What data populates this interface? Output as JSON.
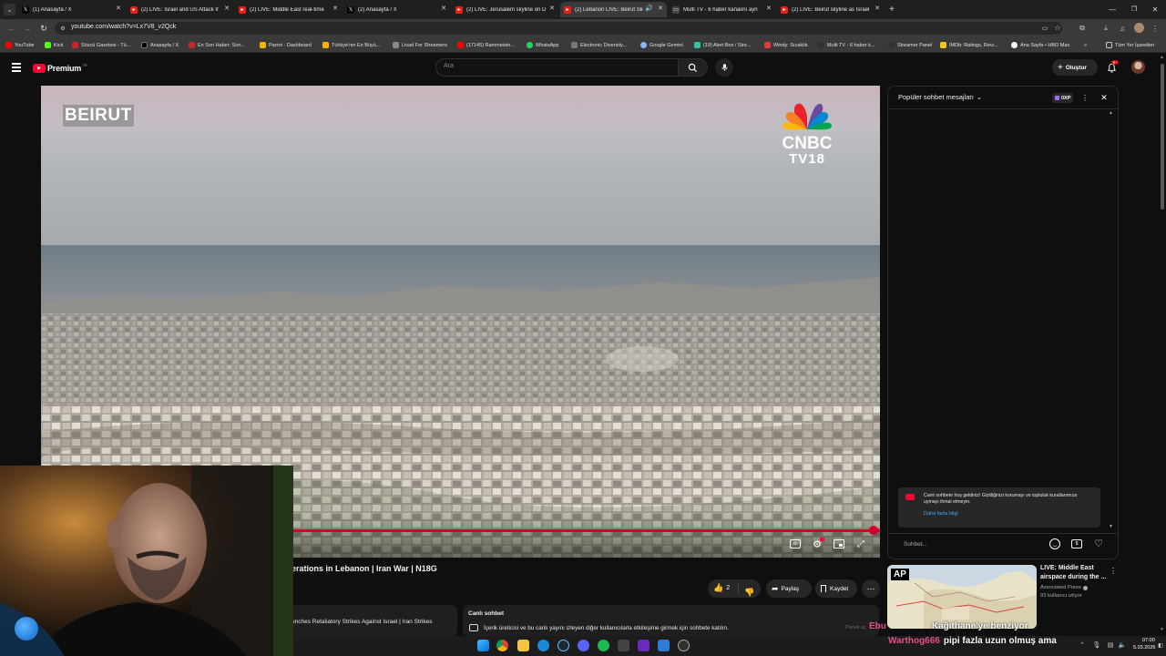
{
  "tabs": [
    {
      "title": "(1) Anasayfa / X",
      "favicon": "x-icon"
    },
    {
      "title": "(2) LIVE: Israel and US Attack Ir",
      "favicon": "youtube-icon"
    },
    {
      "title": "(2) LIVE: Middle East real-time",
      "favicon": "youtube-icon"
    },
    {
      "title": "(2) Anasayfa / X",
      "favicon": "x-icon"
    },
    {
      "title": "(2) LIVE: Jerusalem skyline on D",
      "favicon": "youtube-icon"
    },
    {
      "title": "(2) Lebanon LIVE: Beirut Sk",
      "favicon": "youtube-icon"
    },
    {
      "title": "Multi TV - 6 haber kanalını ayn",
      "favicon": "tv-icon"
    },
    {
      "title": "(2) LIVE: Beirut skyline as Israel",
      "favicon": "youtube-icon"
    }
  ],
  "address": {
    "url": "youtube.com/watch?v=Lx7V8_v2Qck"
  },
  "bookmarks": [
    {
      "label": "YouTube",
      "color": "#ff0000"
    },
    {
      "label": "Kick",
      "color": "#53fc18"
    },
    {
      "label": "Sözcü Gazetesi - Tü...",
      "color": "#d0202a"
    },
    {
      "label": "Anasayfa / X",
      "color": "#000000"
    },
    {
      "label": "En Son Haber: Son...",
      "color": "#c62828"
    },
    {
      "label": "Parrot - Dashboard",
      "color": "#f4b400"
    },
    {
      "label": "Türkiye'nin En Büyü...",
      "color": "#ffb300"
    },
    {
      "label": "Livad For Streamers",
      "color": "#888888"
    },
    {
      "label": "(17145) Rammstein...",
      "color": "#ff0000"
    },
    {
      "label": "WhatsApp",
      "color": "#25d366"
    },
    {
      "label": "Electronic Diversity...",
      "color": "#777777"
    },
    {
      "label": "Google Gemini",
      "color": "#8ab4f8"
    },
    {
      "label": "(19) Alert Box / Stre...",
      "color": "#31c3a2"
    },
    {
      "label": "Windy: Sıcaklık",
      "color": "#e53935"
    },
    {
      "label": "Multi TV - 6 haber k...",
      "color": "#333333"
    },
    {
      "label": "Streamer Panel",
      "color": "#333333"
    },
    {
      "label": "IMDb: Ratings, Revi...",
      "color": "#f5c518"
    },
    {
      "label": "Ana Sayfa • HBO Max",
      "color": "#ffffff"
    }
  ],
  "bookmarks_more": "»",
  "bookmarks_all": "Tüm Yer İşaretleri",
  "yt": {
    "logo_text": "Premium",
    "logo_badge": "TR",
    "search_placeholder": "Ara",
    "create_label": "Oluştur",
    "notif_count": "9+"
  },
  "video": {
    "location_overlay": "BEIRUT",
    "channel_logo_line1": "CNBC",
    "channel_logo_line2": "TV18",
    "progress": 1.0
  },
  "below_video": {
    "title_fragment": "erations in Lebanon | Iran War | N18G",
    "like_count": "2",
    "share_label": "Paylaş",
    "save_label": "Kaydet",
    "related_fragment": "unches Retaliatory Strikes Against Israel | Iran Strikes",
    "live_chat_title": "Canlı sohbet",
    "live_chat_desc": "İçerik üreticisi ve bu canlı yayını izleyen diğer kullanıcılarla etkileşime girmek için sohbete katılın.",
    "faded_text": "Paneli aç"
  },
  "chat": {
    "header_label": "Popüler sohbet mesajları",
    "points_label": "0XP",
    "welcome_text": "Canlı sohbete hoş geldiniz! Gizliliğinizi korumayı ve topluluk kurallarımıza uymayı ihmal etmeyin.",
    "learn_more": "Daha fazla bilgi",
    "input_placeholder": "Sohbet..."
  },
  "sidebar_video": {
    "badge": "AP",
    "title_line1": "LIVE: Middle East",
    "title_line2": "airspace during the ...",
    "channel": "Associated Press",
    "viewers": "93 kullanıcı izliyor"
  },
  "overlay_chat": [
    {
      "user": "Ebu",
      "message": "Kağıthane'ye benziyor"
    },
    {
      "user": "Warthog666",
      "message": "pipi fazla uzun olmuş ama"
    }
  ],
  "taskbar": {
    "time": "07:00",
    "date": "5.03.2026"
  },
  "colors": {
    "yt_red": "#ff0033",
    "chat_accent": "#3ea6ff"
  }
}
